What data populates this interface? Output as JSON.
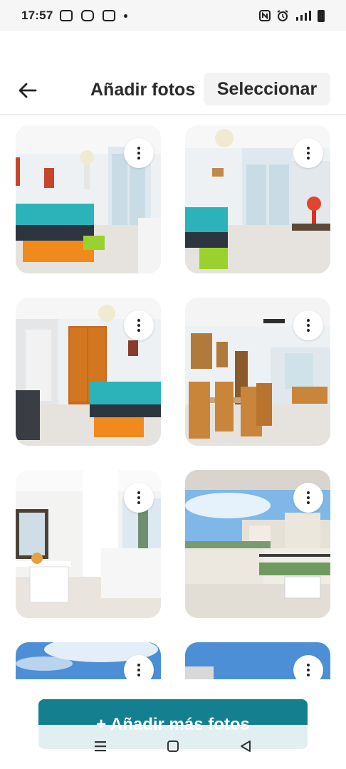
{
  "status_bar": {
    "time": "17:57",
    "right_text": "°éİ█"
  },
  "header": {
    "back_icon": "arrow-left-icon",
    "title": "Añadir fotos",
    "select_label": "Seleccionar"
  },
  "photos": [
    {
      "name": "bedroom-1",
      "scene": "bedroom"
    },
    {
      "name": "bedroom-2",
      "scene": "bedroom"
    },
    {
      "name": "bedroom-3",
      "scene": "bedroom"
    },
    {
      "name": "dining-room",
      "scene": "dining"
    },
    {
      "name": "living-room",
      "scene": "living"
    },
    {
      "name": "balcony",
      "scene": "balcony"
    },
    {
      "name": "exterior-1",
      "scene": "sky"
    },
    {
      "name": "exterior-2",
      "scene": "sky"
    }
  ],
  "cta": {
    "label": "+ Añadir más fotos"
  },
  "colors": {
    "accent": "#137f8f",
    "background": "#ffffff",
    "statusbar": "#f6f6f6"
  },
  "nav": {
    "menu_icon": "recent-apps-icon",
    "home_icon": "home-icon",
    "back_icon": "back-triangle-icon"
  }
}
